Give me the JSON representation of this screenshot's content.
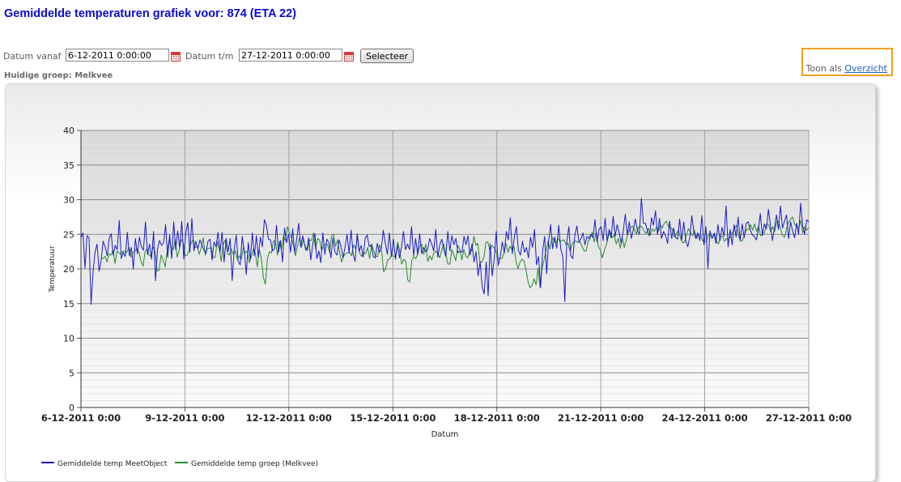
{
  "page": {
    "title": "Gemiddelde temperaturen grafiek voor: 874 (ETA 22)",
    "group_label": "Huidige groep: Melkvee"
  },
  "filter": {
    "from_label": "Datum vanaf",
    "from_value": "6-12-2011 0:00:00",
    "to_label": "Datum t/m",
    "to_value": "27-12-2011 0:00:00",
    "select_button": "Selecteer"
  },
  "view_toggle": {
    "text": "Toon als",
    "link": "Overzicht"
  },
  "colors": {
    "title": "#0a0ad2",
    "series_meetobject": "#1c1cc8",
    "series_groep": "#2a8a2a",
    "highlight_border": "#f0a01e"
  },
  "chart_data": {
    "type": "line",
    "xlabel": "Datum",
    "ylabel": "Temperatuur",
    "ylim": [
      0,
      40
    ],
    "y_ticks": [
      "0",
      "5",
      "10",
      "15",
      "20",
      "25",
      "30",
      "35",
      "40"
    ],
    "x_tick_labels": [
      "6-12-2011 0:00",
      "9-12-2011 0:00",
      "12-12-2011 0:00",
      "15-12-2011 0:00",
      "18-12-2011 0:00",
      "21-12-2011 0:00",
      "24-12-2011 0:00",
      "27-12-2011 0:00"
    ],
    "grid": true,
    "legend": "bottom-left",
    "x_start": "6-12-2011 0:00",
    "x_end": "27-12-2011 0:00",
    "series": [
      {
        "name": "Gemiddelde temp MeetObject",
        "values": [
          24.5,
          25.2,
          20.1,
          24.8,
          24.5,
          14.9,
          19.5,
          22.4,
          23.6,
          19.7,
          21.2,
          24.0,
          23.2,
          21.9,
          24.4,
          25.1,
          22.0,
          23.4,
          22.8,
          27.0,
          21.5,
          22.4,
          21.8,
          25.3,
          21.9,
          23.1,
          20.0,
          24.4,
          22.2,
          24.6,
          23.2,
          22.7,
          26.8,
          22.1,
          23.6,
          21.4,
          25.4,
          18.3,
          22.9,
          24.1,
          23.4,
          23.8,
          26.4,
          21.7,
          24.9,
          21.5,
          26.8,
          22.8,
          25.5,
          23.0,
          26.9,
          21.4,
          25.2,
          26.7,
          22.4,
          27.3,
          22.6,
          24.0,
          22.9,
          24.2,
          23.5,
          22.7,
          22.3,
          24.0,
          24.3,
          21.3,
          23.9,
          23.2,
          25.3,
          22.4,
          25.3,
          21.0,
          24.4,
          22.5,
          24.4,
          18.3,
          22.8,
          24.9,
          21.1,
          20.6,
          24.7,
          22.6,
          19.2,
          23.8,
          21.3,
          25.2,
          21.9,
          24.8,
          21.7,
          24.6,
          23.2,
          27.1,
          26.3,
          24.3,
          24.2,
          22.6,
          23.0,
          26.3,
          22.4,
          24.1,
          21.0,
          25.9,
          23.8,
          25.0,
          22.4,
          25.8,
          22.3,
          24.3,
          26.6,
          23.2,
          24.8,
          23.4,
          22.7,
          24.5,
          21.3,
          23.6,
          25.1,
          21.5,
          22.6,
          20.9,
          25.2,
          22.1,
          24.3,
          23.8,
          21.6,
          24.5,
          22.4,
          22.0,
          24.2,
          23.3,
          21.6,
          23.1,
          25.0,
          22.3,
          25.6,
          22.2,
          21.1,
          25.1,
          22.5,
          23.4,
          21.7,
          24.4,
          24.9,
          23.2,
          23.5,
          21.8,
          21.6,
          23.7,
          22.4,
          23.0,
          25.6,
          23.7,
          22.1,
          25.2,
          21.8,
          24.3,
          21.4,
          23.5,
          21.6,
          23.2,
          25.4,
          22.8,
          23.6,
          22.8,
          26.1,
          21.9,
          24.4,
          22.1,
          25.1,
          22.2,
          23.1,
          22.5,
          22.8,
          24.4,
          23.6,
          22.6,
          25.7,
          21.7,
          23.5,
          24.3,
          22.7,
          21.8,
          25.4,
          22.6,
          24.8,
          23.5,
          24.4,
          22.3,
          22.6,
          22.4,
          24.7,
          23.5,
          24.8,
          22.0,
          23.6,
          21.0,
          22.5,
          19.0,
          21.1,
          17.4,
          16.4,
          21.0,
          16.1,
          23.6,
          19.0,
          21.4,
          25.4,
          20.5,
          21.8,
          23.9,
          22.3,
          25.4,
          24.2,
          27.4,
          22.2,
          24.7,
          26.1,
          22.7,
          22.0,
          24.0,
          22.4,
          23.1,
          21.6,
          24.6,
          23.1,
          25.7,
          20.6,
          21.8,
          17.3,
          22.6,
          24.7,
          19.3,
          24.1,
          26.4,
          22.9,
          24.6,
          23.0,
          26.3,
          22.9,
          21.8,
          15.3,
          24.0,
          26.1,
          21.9,
          21.5,
          24.9,
          26.2,
          23.9,
          24.3,
          25.2,
          23.5,
          24.7,
          24.4,
          25.0,
          24.5,
          27.1,
          23.9,
          25.7,
          26.1,
          24.1,
          27.3,
          24.0,
          25.7,
          24.5,
          27.6,
          24.7,
          26.4,
          25.2,
          23.7,
          25.5,
          27.9,
          24.9,
          26.8,
          24.4,
          25.7,
          27.2,
          25.6,
          25.0,
          30.2,
          26.6,
          26.6,
          25.4,
          24.8,
          27.4,
          26.3,
          28.4,
          25.0,
          27.3,
          24.4,
          25.4,
          24.8,
          23.7,
          26.9,
          24.4,
          25.9,
          24.5,
          24.3,
          27.2,
          24.1,
          26.8,
          24.1,
          23.2,
          24.6,
          27.7,
          25.4,
          24.4,
          25.2,
          24.1,
          27.7,
          23.5,
          26.1,
          20.1,
          25.5,
          24.4,
          25.1,
          23.7,
          26.4,
          24.1,
          26.0,
          24.7,
          29.1,
          23.2,
          25.7,
          23.5,
          26.4,
          24.6,
          27.5,
          24.1,
          26.5,
          24.5,
          26.6,
          26.8,
          25.6,
          24.9,
          24.7,
          24.2,
          25.6,
          28.0,
          24.9,
          26.5,
          25.8,
          28.6,
          26.3,
          24.1,
          25.9,
          27.8,
          25.7,
          29.1,
          25.9,
          26.9,
          27.8,
          24.4,
          26.8,
          25.5,
          24.5,
          26.6,
          25.0,
          29.5,
          26.2,
          25.0,
          27.1,
          26.8
        ]
      },
      {
        "name": "Gemiddelde temp groep (Melkvee)",
        "values": [
          21.6,
          21.5,
          21.8,
          21.0,
          22.2,
          22.0,
          22.7,
          20.8,
          22.6,
          22.3,
          22.1,
          22.6,
          22.5,
          22.4,
          23.2,
          21.7,
          22.4,
          22.6,
          23.0,
          22.3,
          21.1,
          20.4,
          22.5,
          22.9,
          22.0,
          21.8,
          23.2,
          22.5,
          19.7,
          19.8,
          22.0,
          21.3,
          20.3,
          22.5,
          24.2,
          23.1,
          22.7,
          24.3,
          21.7,
          22.7,
          24.3,
          23.8,
          21.9,
          22.0,
          22.8,
          23.8,
          24.3,
          23.1,
          23.3,
          22.1,
          23.1,
          24.5,
          22.0,
          22.9,
          23.0,
          23.1,
          21.6,
          21.7,
          24.0,
          22.9,
          21.1,
          23.6,
          24.2,
          22.3,
          22.0,
          22.9,
          22.1,
          22.6,
          21.4,
          21.9,
          21.4,
          23.1,
          22.3,
          22.6,
          20.9,
          21.8,
          22.9,
          22.3,
          20.3,
          22.8,
          21.5,
          18.8,
          17.8,
          21.4,
          22.5,
          22.3,
          24.0,
          24.1,
          22.0,
          24.0,
          22.8,
          24.7,
          24.1,
          26.1,
          25.2,
          24.5,
          23.4,
          21.9,
          23.2,
          24.5,
          23.1,
          24.4,
          22.8,
          22.7,
          24.2,
          24.1,
          25.2,
          22.9,
          24.4,
          24.2,
          22.7,
          23.2,
          23.6,
          23.5,
          22.4,
          24.7,
          25.0,
          23.3,
          24.2,
          22.4,
          21.0,
          21.8,
          22.2,
          22.3,
          22.4,
          21.9,
          23.5,
          22.9,
          24.8,
          22.3,
          21.8,
          22.4,
          22.2,
          23.1,
          21.5,
          23.6,
          22.6,
          21.8,
          21.8,
          23.5,
          22.5,
          19.6,
          20.1,
          21.3,
          21.5,
          22.1,
          21.8,
          21.9,
          23.9,
          22.6,
          20.7,
          21.4,
          21.1,
          18.4,
          18.1,
          21.2,
          21.8,
          21.5,
          22.1,
          23.3,
          23.6,
          22.1,
          23.6,
          21.1,
          21.9,
          21.3,
          22.3,
          22.6,
          22.2,
          21.6,
          22.8,
          23.6,
          22.2,
          20.7,
          20.7,
          22.8,
          22.0,
          21.2,
          23.4,
          22.8,
          21.3,
          22.8,
          21.8,
          21.6,
          22.8,
          22.6,
          24.7,
          23.4,
          23.7,
          21.0,
          21.0,
          21.7,
          23.9,
          23.9,
          22.6,
          23.4,
          23.1,
          22.6,
          21.3,
          21.6,
          21.5,
          22.3,
          23.7,
          22.4,
          23.3,
          22.8,
          23.3,
          21.1,
          20.0,
          21.0,
          21.4,
          21.2,
          19.8,
          18.2,
          17.3,
          17.6,
          18.6,
          17.7,
          20.1,
          17.3,
          20.1,
          21.3,
          22.7,
          24.0,
          22.9,
          24.6,
          24.0,
          23.8,
          24.4,
          23.9,
          24.1,
          24.2,
          23.5,
          23.7,
          22.5,
          23.6,
          24.0,
          24.0,
          23.8,
          23.9,
          23.2,
          22.6,
          22.6,
          24.0,
          24.4,
          25.3,
          23.9,
          25.4,
          23.3,
          22.8,
          21.6,
          22.6,
          23.5,
          24.6,
          25.4,
          24.5,
          24.9,
          23.6,
          24.4,
          23.0,
          24.5,
          23.1,
          24.2,
          25.3,
          25.9,
          26.2,
          25.8,
          25.0,
          26.0,
          26.2,
          26.0,
          25.4,
          25.1,
          25.9,
          24.9,
          25.8,
          25.4,
          26.0,
          25.4,
          26.4,
          25.9,
          26.6,
          26.9,
          26.1,
          26.0,
          25.7,
          24.6,
          25.0,
          25.6,
          24.5,
          23.8,
          23.8,
          24.9,
          25.8,
          25.3,
          24.8,
          25.6,
          24.4,
          25.0,
          25.0,
          24.1,
          23.9,
          24.0,
          25.0,
          24.8,
          24.5,
          25.2,
          24.0,
          23.6,
          24.7,
          24.7,
          24.0,
          24.4,
          24.2,
          24.7,
          25.3,
          25.9,
          26.3,
          24.8,
          24.0,
          24.1,
          25.0,
          25.7,
          25.7,
          26.4,
          25.6,
          26.5,
          25.4,
          26.2,
          24.8,
          24.9,
          25.3,
          26.5,
          26.4,
          25.4,
          26.1,
          25.4,
          26.8,
          26.9,
          25.7,
          24.8,
          24.6,
          25.9,
          26.8,
          27.2,
          27.5,
          26.4,
          26.2,
          25.9,
          27.0,
          25.2,
          26.1,
          25.6,
          26.0
        ]
      }
    ]
  }
}
